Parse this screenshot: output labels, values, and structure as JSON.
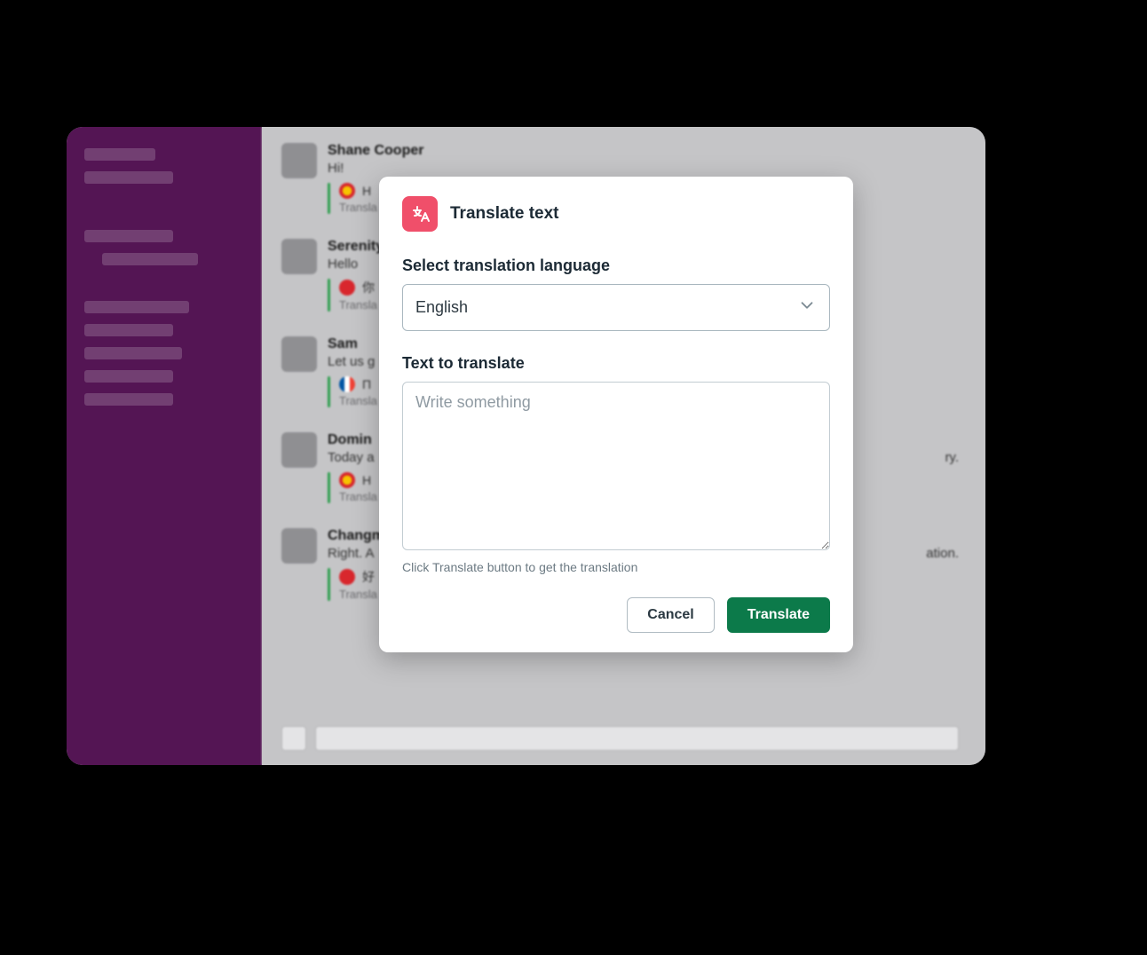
{
  "messages": [
    {
      "name": "Shane Cooper",
      "text": "Hi!",
      "flag": "es",
      "trText": "H",
      "trSub": "Transla"
    },
    {
      "name": "Serenity",
      "text": "Hello",
      "flag": "cn",
      "trText": "你",
      "trSub": "Transla"
    },
    {
      "name": "Sam",
      "text": "Let us g",
      "flag": "fr",
      "trText": "П",
      "trSub": "Transla"
    },
    {
      "name": "Domin",
      "text": "Today a",
      "textTrail": "ry.",
      "flag": "es",
      "trText": "H",
      "trSub": "Transla"
    },
    {
      "name": "Changm",
      "text": "Right. A",
      "textTrail": "ation.",
      "flag": "cn",
      "trText": "好",
      "trSub": "Transla"
    }
  ],
  "modal": {
    "title": "Translate text",
    "languageLabel": "Select translation language",
    "languageValue": "English",
    "textLabel": "Text to translate",
    "textPlaceholder": "Write something",
    "hint": "Click Translate button to get the translation",
    "cancel": "Cancel",
    "translate": "Translate"
  }
}
